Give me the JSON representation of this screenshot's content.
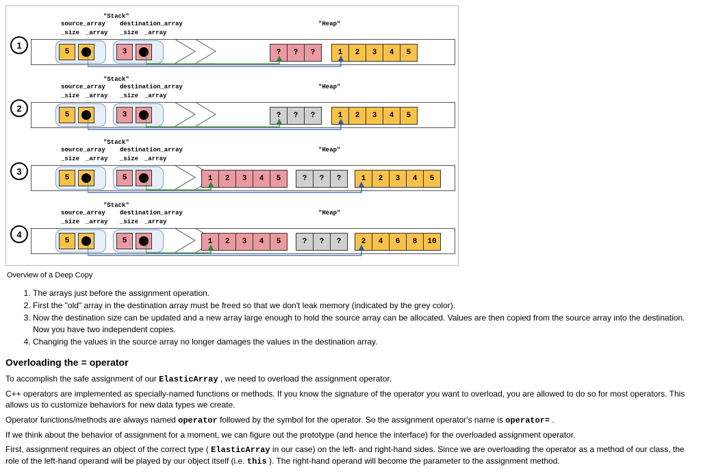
{
  "diagram": {
    "caption": "Overview of a Deep Copy",
    "top_labels": {
      "stack": "\"Stack\"",
      "source_array": "source_array",
      "destination_array": "destination_array",
      "size": "_size",
      "array": "_array",
      "heap": "\"Heap\""
    },
    "steps": {
      "s1": {
        "num": "1",
        "src_size": "5",
        "dest_size": "3",
        "heap_a": [
          "?",
          "?",
          "?"
        ],
        "heap_a_color": "pink",
        "heap_b": [
          "1",
          "2",
          "3",
          "4",
          "5"
        ],
        "heap_b_color": "orange"
      },
      "s2": {
        "num": "2",
        "src_size": "5",
        "dest_size": "3",
        "heap_a": [
          "?",
          "?",
          "?"
        ],
        "heap_a_color": "grey",
        "heap_b": [
          "1",
          "2",
          "3",
          "4",
          "5"
        ],
        "heap_b_color": "orange"
      },
      "s3": {
        "num": "3",
        "src_size": "5",
        "dest_size": "5",
        "heap_c": [
          "1",
          "2",
          "3",
          "4",
          "5"
        ],
        "heap_c_color": "pink",
        "heap_a": [
          "?",
          "?",
          "?"
        ],
        "heap_a_color": "grey",
        "heap_b": [
          "1",
          "2",
          "3",
          "4",
          "5"
        ],
        "heap_b_color": "orange"
      },
      "s4": {
        "num": "4",
        "src_size": "5",
        "dest_size": "5",
        "heap_c": [
          "1",
          "2",
          "3",
          "4",
          "5"
        ],
        "heap_c_color": "pink",
        "heap_a": [
          "?",
          "?",
          "?"
        ],
        "heap_a_color": "grey",
        "heap_b": [
          "2",
          "4",
          "6",
          "8",
          "10"
        ],
        "heap_b_color": "orange"
      }
    }
  },
  "list": {
    "i1": "The arrays just before the assignment operation.",
    "i2": "First the \"old\" array in the destination array must be freed so that we don't leak memory (indicated by the grey color).",
    "i3": "Now the destination size can be updated and a new array large enough to hold the source array can be allocated. Values are then copied from the source array into the destination. Now you have two independent copies.",
    "i4": "Changing the values in the source array no longer damages the values in the destination array."
  },
  "heading": {
    "pre": "Overloading the ",
    "code": "=",
    "post": " operator"
  },
  "para": {
    "p1a": "To accomplish the safe assignment of our ",
    "p1code": "ElasticArray",
    "p1b": " , we need to overload the assignment operator.",
    "p2": "C++ operators are implemented as specially-named functions or methods. If you know the signature of the operator you want to overload, you are allowed to do so for most operators. This allows us to customize behaviors for new data types we create.",
    "p3a": "Operator functions/methods are always named ",
    "p3code1": "operator",
    "p3b": " followed by the symbol for the operator. So the assignment operator's name is ",
    "p3code2": "operator=",
    "p3c": " .",
    "p4": "If we think about the behavior of assignment for a moment, we can figure out the prototype (and hence the interface) for the overloaded assignment operator.",
    "p5a": "First, assignment requires an object of the correct type ( ",
    "p5code1": "ElasticArray",
    "p5b": " in our case) on the left- and right-hand sides. Since we are overloading the operator as a method of our class, the role of the left-hand operand will be played by our object itself (i.e. ",
    "p5code2": "this",
    "p5c": " ). The right-hand operand will become the parameter to the assignment method."
  }
}
